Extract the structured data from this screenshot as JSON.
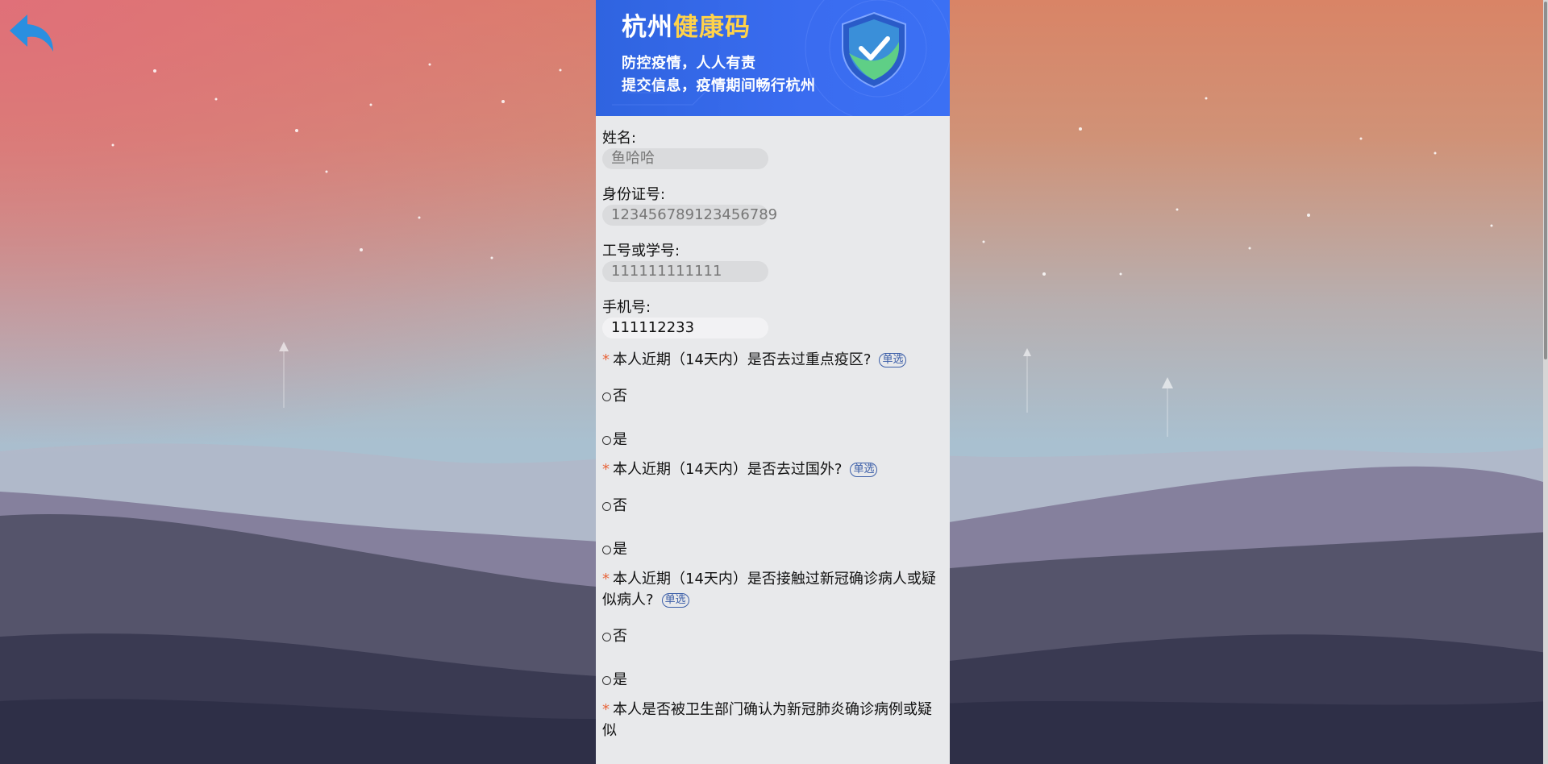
{
  "banner": {
    "title_white": "杭州",
    "title_yellow": "健康码",
    "line1": "防控疫情，人人有责",
    "line2": "提交信息，疫情期间畅行杭州"
  },
  "fields": [
    {
      "label": "姓名:",
      "value": "鱼哈哈",
      "editable": false
    },
    {
      "label": "身份证号:",
      "value": "123456789123456789",
      "editable": false
    },
    {
      "label": "工号或学号:",
      "value": "111111111111",
      "editable": false
    },
    {
      "label": "手机号:",
      "value": "111112233",
      "editable": true
    }
  ],
  "questions": [
    {
      "required": "*",
      "text": "本人近期（14天内）是否去过重点疫区?",
      "tag": "单选",
      "options": [
        "否",
        "是"
      ]
    },
    {
      "required": "*",
      "text": "本人近期（14天内）是否去过国外?",
      "tag": "单选",
      "options": [
        "否",
        "是"
      ]
    },
    {
      "required": "*",
      "text": "本人近期（14天内）是否接触过新冠确诊病人或疑似病人?",
      "tag": "单选",
      "options": [
        "否",
        "是"
      ]
    },
    {
      "required": "*",
      "text": "本人是否被卫生部门确认为新冠肺炎确诊病例或疑似",
      "tag": "",
      "options": []
    }
  ],
  "colors": {
    "accent_blue": "#2f64e0",
    "highlight_yellow": "#ffd24a",
    "required_star": "#e8643a",
    "panel_bg": "#e8e9eb",
    "back_icon": "#2a8fe0"
  },
  "icons": {
    "back": "back-arrow-icon",
    "shield": "shield-check-icon"
  }
}
